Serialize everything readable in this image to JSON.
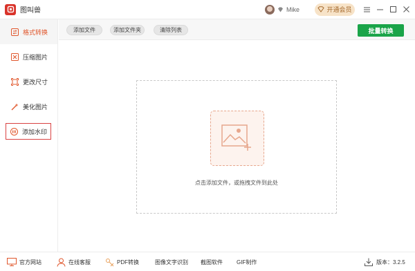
{
  "app": {
    "title": "图叫兽"
  },
  "user": {
    "name": "Mike"
  },
  "vip": {
    "label": "开通会员"
  },
  "window": {
    "menu_icon": "menu-icon",
    "min_icon": "minimize-icon",
    "max_icon": "maximize-icon",
    "close_icon": "close-icon"
  },
  "sidebar": {
    "items": [
      {
        "label": "格式转换",
        "icon": "format-convert-icon",
        "active": true
      },
      {
        "label": "压缩图片",
        "icon": "compress-icon"
      },
      {
        "label": "更改尺寸",
        "icon": "resize-icon"
      },
      {
        "label": "美化图片",
        "icon": "beautify-icon"
      },
      {
        "label": "添加水印",
        "icon": "watermark-icon",
        "highlighted": true
      }
    ]
  },
  "toolbar": {
    "add_file": "添加文件",
    "add_folder": "添加文件夹",
    "clear_list": "清除列表",
    "batch_convert": "批量转换"
  },
  "dropzone": {
    "hint": "点击添加文件，或拖拽文件到此处"
  },
  "footer": {
    "website": "官方网站",
    "support": "在线客服",
    "pdf": "PDF转换",
    "ocr": "图像文字识别",
    "screenshot": "截图软件",
    "gif": "GIF制作",
    "version": "版本：3.2.5"
  },
  "colors": {
    "accent": "#e0552a",
    "primary_green": "#1aa449",
    "brand_red": "#d9332a",
    "vip_gold": "#a5682a"
  }
}
